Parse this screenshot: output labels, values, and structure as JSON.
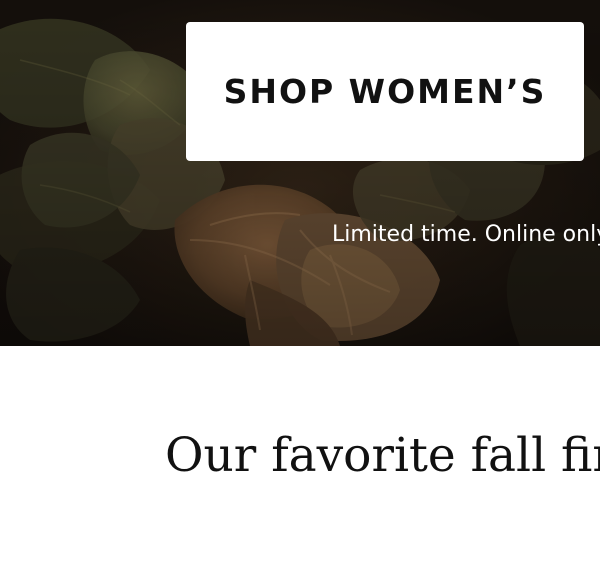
{
  "hero": {
    "cta_label": "SHOP WOMEN’S",
    "promo_text": "Limited time. Online only."
  },
  "section": {
    "heading": "Our favorite fall finds"
  }
}
